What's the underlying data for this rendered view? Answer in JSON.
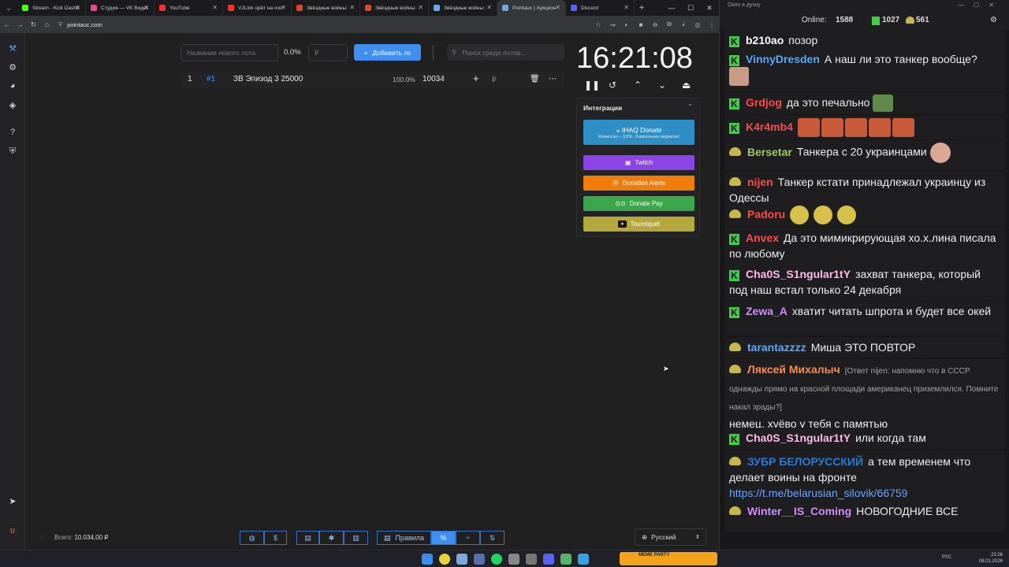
{
  "browser": {
    "tabs": [
      {
        "title": "Stream - Kick Dashb",
        "color": "#53fc18"
      },
      {
        "title": "Студия — VK Видео",
        "color": "#e84a8a"
      },
      {
        "title": "YouTube",
        "color": "#ff2d2d"
      },
      {
        "title": "VJLink орёт на пос",
        "color": "#ff2d2d"
      },
      {
        "title": "Звёздные войны:",
        "color": "#d94a2a"
      },
      {
        "title": "Звёздные войны:",
        "color": "#d94a2a"
      },
      {
        "title": "Звёздные войны:",
        "color": "#6aa8e8"
      },
      {
        "title": "Pointauc | Аукцион",
        "color": "#6aa8e8"
      },
      {
        "title": "Discord",
        "color": "#5865f2"
      }
    ],
    "url": "pointauc.com"
  },
  "auction": {
    "new_lot_placeholder": "Название нового лота",
    "percent": "0.0%",
    "currency_placeholder": "₽",
    "add_button": "Добавить лс",
    "search_placeholder": "Поиск среди лотов...",
    "lot": {
      "index": "1",
      "id": "#1",
      "name": "ЗВ Эпизод 3 25000",
      "percent": "100.0%",
      "amount": "10034",
      "currency": "₽"
    },
    "timer": "16:21:08",
    "total_label": "Всего:",
    "total_value": "10.034,00 ₽",
    "rules_label": "Правила",
    "language": "Русский"
  },
  "integrations": {
    "title": "Интеграции",
    "buttons": [
      {
        "label": "IHAQ Donate",
        "sub": "Комиссия – 3,5%. Уникальные виджеты!",
        "color": "#2f8ec4"
      },
      {
        "label": "Twitch",
        "color": "#8b45e6"
      },
      {
        "label": "Donation Alerts",
        "color": "#f07d0a"
      },
      {
        "label": "Donate Pay",
        "color": "#3aa84a"
      },
      {
        "label": "Tourniquet",
        "color": "#b4a83c"
      }
    ]
  },
  "chat": {
    "window_title": "Окно в духку",
    "online_label": "Online:",
    "online_count": "1588",
    "kick_count": "1027",
    "other_count": "561",
    "messages": [
      {
        "user": "b210ao",
        "color": "#ffffff",
        "badge": "kick",
        "text": "позор"
      },
      {
        "user": "VinnyDresden",
        "color": "#5aa8ff",
        "badge": "kick",
        "text": "А наш ли это танкер вообще?"
      },
      {
        "user": "Grdjog",
        "color": "#ff4a4a",
        "badge": "kick",
        "text": "да это печально"
      },
      {
        "user": "K4r4mb4",
        "color": "#ff4a4a",
        "badge": "kick",
        "text": ""
      },
      {
        "user": "Bersetar",
        "color": "#9acd5a",
        "badge": "other",
        "text": "Танкера с 20 украинцами"
      },
      {
        "user": "nijen",
        "color": "#ff4a4a",
        "badge": "other",
        "text": "Танкер кстати принадлежал украинцу из Одессы"
      },
      {
        "user": "Padoru",
        "color": "#ff4a4a",
        "badge": "other",
        "text": ""
      },
      {
        "user": "Anvex",
        "color": "#ff4a4a",
        "badge": "kick",
        "text": "Да это мимикрирующая хо.х.лина писала по любому"
      },
      {
        "user": "Cha0S_S1ngular1tY",
        "color": "#ffb8e8",
        "badge": "kick",
        "text": "захват танкера, который под наш встал только 24 декабря"
      },
      {
        "user": "Zewa_A",
        "color": "#d38cff",
        "badge": "kick",
        "text": "хватит читать шпрота и будет все окей"
      },
      {
        "user": "tarantazzzz",
        "color": "#5aa8ff",
        "badge": "other",
        "text": "Миша ЭТО ПОВТОР"
      },
      {
        "user": "Ляксей Михалыч",
        "color": "#ff8a4a",
        "badge": "other",
        "reply": "[Ответ nijen: напомню что в СССР однажды прямо на красной площади американец приземлился. Помните накал зрады?]",
        "text": "немец. хуёво у тебя с памятью"
      },
      {
        "user": "Cha0S_S1ngular1tY",
        "color": "#ffb8e8",
        "badge": "kick",
        "text": "или когда там"
      },
      {
        "user": "ЗУБР БЕЛОРУССКИЙ",
        "color": "#2a7ad8",
        "badge": "other",
        "text": "а тем временем что делает воины на фронте",
        "link": "https://t.me/belarusian_silovik/66759"
      },
      {
        "user": "Winter__IS_Coming",
        "color": "#d38cff",
        "badge": "other",
        "text": "НОВОГОДНИЕ ВСЕ"
      }
    ]
  },
  "taskbar": {
    "lang": "РУС",
    "time": "23:26",
    "date": "08.01.2026",
    "widget": "MEME PARTY"
  }
}
